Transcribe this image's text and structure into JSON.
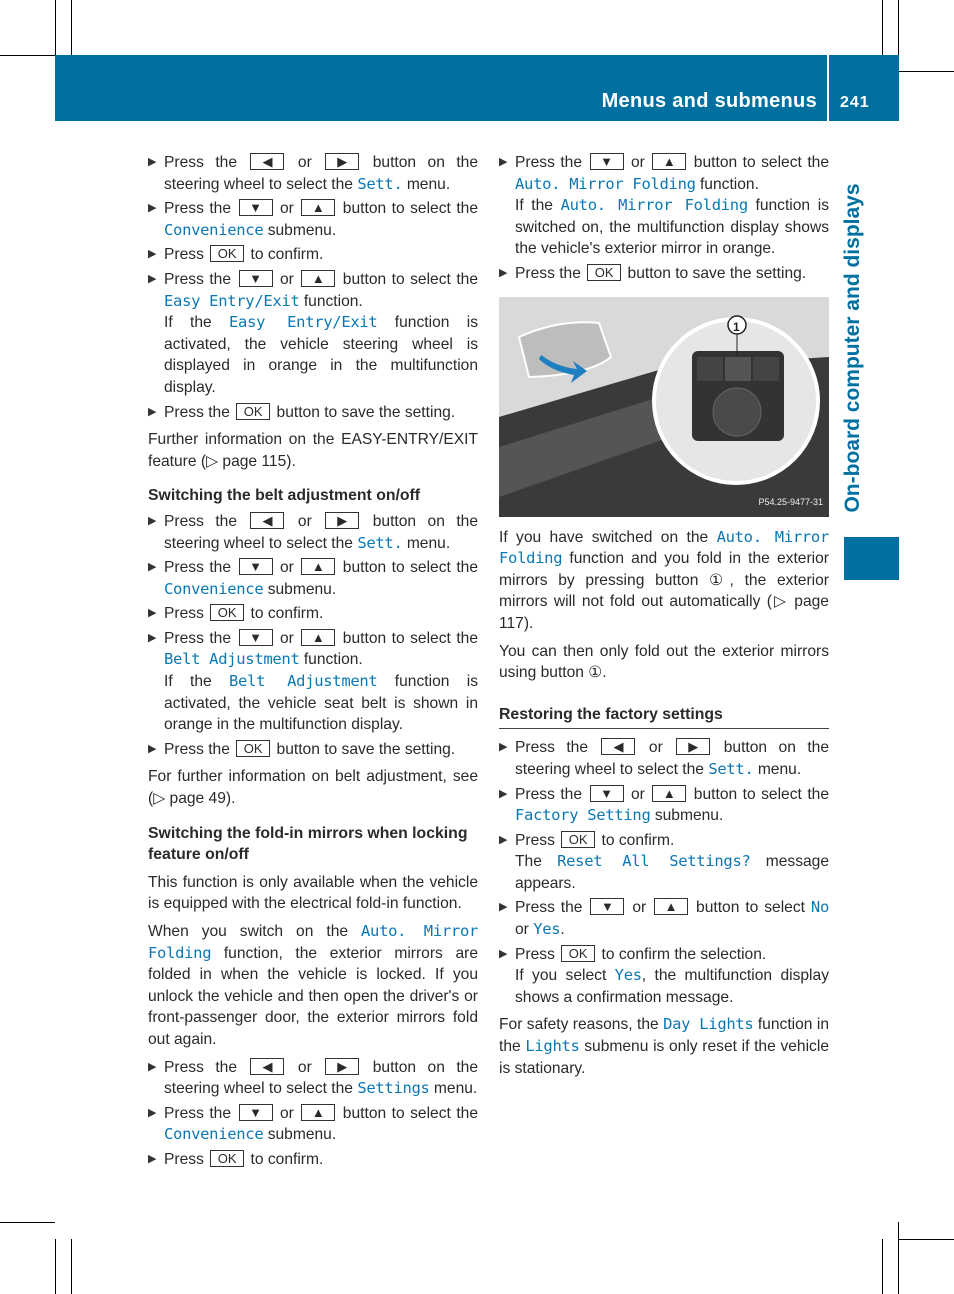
{
  "header": {
    "title": "Menus and submenus",
    "page_number": "241"
  },
  "side_tab": {
    "label": "On-board computer and displays"
  },
  "colors": {
    "brand": "#0070a1",
    "mono_text": "#0a78b4"
  },
  "columns": {
    "left": [
      {
        "type": "step",
        "segs": [
          "Press the ",
          {
            "k": "◀"
          },
          " or ",
          {
            "k": "▶"
          },
          " button on the steering wheel to select the ",
          {
            "m": "Sett."
          },
          " menu."
        ]
      },
      {
        "type": "step",
        "segs": [
          "Press the ",
          {
            "k": "▼"
          },
          " or ",
          {
            "k": "▲"
          },
          " button to select the ",
          {
            "m": "Convenience"
          },
          " submenu."
        ]
      },
      {
        "type": "step",
        "segs": [
          "Press ",
          {
            "k": "OK"
          },
          " to confirm."
        ]
      },
      {
        "type": "step",
        "segs": [
          "Press the ",
          {
            "k": "▼"
          },
          " or ",
          {
            "k": "▲"
          },
          " button to select the ",
          {
            "m": "Easy Entry/Exit"
          },
          " function.",
          {
            "br": 1
          },
          "If the ",
          {
            "m": "Easy Entry/Exit"
          },
          " function is activated, the vehicle steering wheel is displayed in orange in the multifunction display."
        ]
      },
      {
        "type": "step",
        "segs": [
          "Press the ",
          {
            "k": "OK"
          },
          " button to save the setting."
        ]
      },
      {
        "type": "p",
        "segs": [
          "Further information on the EASY-ENTRY/EXIT feature (▷ page 115)."
        ]
      },
      {
        "type": "h",
        "segs": [
          "Switching the belt adjustment on/off"
        ]
      },
      {
        "type": "step",
        "segs": [
          "Press the ",
          {
            "k": "◀"
          },
          " or ",
          {
            "k": "▶"
          },
          " button on the steering wheel to select the ",
          {
            "m": "Sett."
          },
          " menu."
        ]
      },
      {
        "type": "step",
        "segs": [
          "Press the ",
          {
            "k": "▼"
          },
          " or ",
          {
            "k": "▲"
          },
          " button to select the ",
          {
            "m": "Convenience"
          },
          " submenu."
        ]
      },
      {
        "type": "step",
        "segs": [
          "Press ",
          {
            "k": "OK"
          },
          " to confirm."
        ]
      },
      {
        "type": "step",
        "segs": [
          "Press the ",
          {
            "k": "▼"
          },
          " or ",
          {
            "k": "▲"
          },
          " button to select the ",
          {
            "m": "Belt Adjustment"
          },
          " function.",
          {
            "br": 1
          },
          "If the ",
          {
            "m": "Belt Adjustment"
          },
          " function is activated, the vehicle seat belt is shown in orange in the multifunction display."
        ]
      },
      {
        "type": "step",
        "segs": [
          "Press the ",
          {
            "k": "OK"
          },
          " button to save the setting."
        ]
      },
      {
        "type": "p",
        "segs": [
          "For further information on belt adjustment, see (▷ page 49)."
        ]
      },
      {
        "type": "h",
        "segs": [
          "Switching the fold-in mirrors when locking feature on/off"
        ]
      },
      {
        "type": "p",
        "segs": [
          "This function is only available when the vehicle is equipped with the electrical fold-in function."
        ]
      },
      {
        "type": "p",
        "segs": [
          "When you switch on the ",
          {
            "m": "Auto. Mirror Folding"
          },
          " function, the exterior mirrors are folded in when the vehicle is locked. If you unlock the vehicle and then open the driver's or front-passenger door, the exterior mirrors fold out again."
        ]
      },
      {
        "type": "step",
        "segs": [
          "Press the ",
          {
            "k": "◀"
          },
          " or ",
          {
            "k": "▶"
          },
          " button on the steering wheel to select the ",
          {
            "m": "Settings"
          },
          " menu."
        ]
      },
      {
        "type": "step",
        "segs": [
          "Press the ",
          {
            "k": "▼"
          },
          " or ",
          {
            "k": "▲"
          },
          " button to select the ",
          {
            "m": "Convenience"
          },
          " submenu."
        ]
      },
      {
        "type": "step",
        "segs": [
          "Press ",
          {
            "k": "OK"
          },
          " to confirm."
        ]
      }
    ],
    "right": [
      {
        "type": "step",
        "segs": [
          "Press the ",
          {
            "k": "▼"
          },
          " or ",
          {
            "k": "▲"
          },
          " button to select the ",
          {
            "m": "Auto. Mirror Folding"
          },
          " function.",
          {
            "br": 1
          },
          "If the ",
          {
            "m": "Auto. Mirror Folding"
          },
          " function is switched on, the multifunction display shows the vehicle's exterior mirror in orange."
        ]
      },
      {
        "type": "step",
        "segs": [
          "Press the ",
          {
            "k": "OK"
          },
          " button to save the setting."
        ]
      },
      {
        "type": "img",
        "callout": "1",
        "code": "P54.25-9477-31"
      },
      {
        "type": "p",
        "segs": [
          "If you have switched on the ",
          {
            "m": "Auto. Mirror Folding"
          },
          " function and you fold in the exterior mirrors by pressing button ①, the exterior mirrors will not fold out automatically (▷ page 117)."
        ]
      },
      {
        "type": "p",
        "segs": [
          "You can then only fold out the exterior mirrors using button ①."
        ]
      },
      {
        "type": "hr",
        "segs": [
          "Restoring the factory settings"
        ]
      },
      {
        "type": "step",
        "segs": [
          "Press the ",
          {
            "k": "◀"
          },
          " or ",
          {
            "k": "▶"
          },
          " button on the steering wheel to select the ",
          {
            "m": "Sett."
          },
          " menu."
        ]
      },
      {
        "type": "step",
        "segs": [
          "Press the ",
          {
            "k": "▼"
          },
          " or ",
          {
            "k": "▲"
          },
          " button to select the ",
          {
            "m": "Factory Setting"
          },
          " submenu."
        ]
      },
      {
        "type": "step",
        "segs": [
          "Press ",
          {
            "k": "OK"
          },
          " to confirm.",
          {
            "br": 1
          },
          "The ",
          {
            "m": "Reset All Settings?"
          },
          " message appears."
        ]
      },
      {
        "type": "step",
        "segs": [
          "Press the ",
          {
            "k": "▼"
          },
          " or ",
          {
            "k": "▲"
          },
          " button to select ",
          {
            "m": "No"
          },
          " or ",
          {
            "m": "Yes"
          },
          "."
        ]
      },
      {
        "type": "step",
        "segs": [
          "Press ",
          {
            "k": "OK"
          },
          " to confirm the selection.",
          {
            "br": 1
          },
          "If you select ",
          {
            "m": "Yes"
          },
          ", the multifunction display shows a confirmation message."
        ]
      },
      {
        "type": "p",
        "segs": [
          "For safety reasons, the ",
          {
            "m": "Day Lights"
          },
          " function in the ",
          {
            "m": "Lights"
          },
          " submenu is only reset if the vehicle is stationary."
        ]
      }
    ]
  }
}
